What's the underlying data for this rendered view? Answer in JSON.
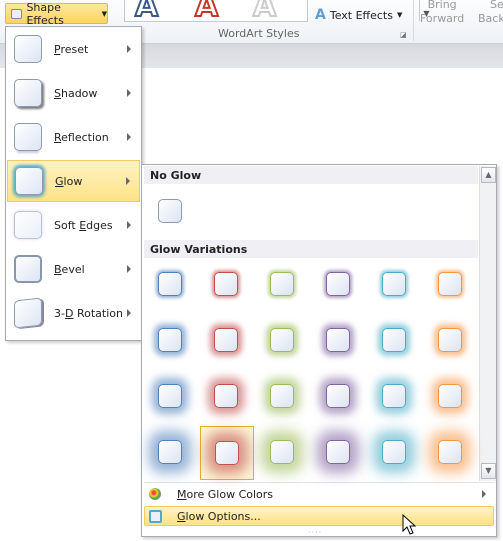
{
  "ribbon": {
    "shape_effects": "Shape Effects",
    "wordart_styles": "WordArt Styles",
    "text_effects": "Text Effects",
    "bring": "Bring",
    "forward": "Forward",
    "send": "Se",
    "backward": "Back",
    "wordart_letter": "A"
  },
  "menu": {
    "items": [
      {
        "pre": "",
        "u": "P",
        "post": "reset"
      },
      {
        "pre": "",
        "u": "S",
        "post": "hadow"
      },
      {
        "pre": "",
        "u": "R",
        "post": "eflection"
      },
      {
        "pre": "",
        "u": "G",
        "post": "low"
      },
      {
        "pre": "Soft ",
        "u": "E",
        "post": "dges"
      },
      {
        "pre": "",
        "u": "B",
        "post": "evel"
      },
      {
        "pre": "3-",
        "u": "D",
        "post": " Rotation"
      }
    ],
    "selected": "Glow"
  },
  "gallery": {
    "no_glow": "No Glow",
    "glow_variations": "Glow Variations",
    "colors": [
      "#4f81bd",
      "#c0504d",
      "#9bbb59",
      "#8064a2",
      "#4bacc6",
      "#f79646"
    ],
    "rows": 4,
    "selected": {
      "row": 4,
      "col": 2
    },
    "more_colors": {
      "u": "M",
      "post": "ore Glow Colors"
    },
    "options": {
      "u": "G",
      "post": "low Options..."
    }
  }
}
